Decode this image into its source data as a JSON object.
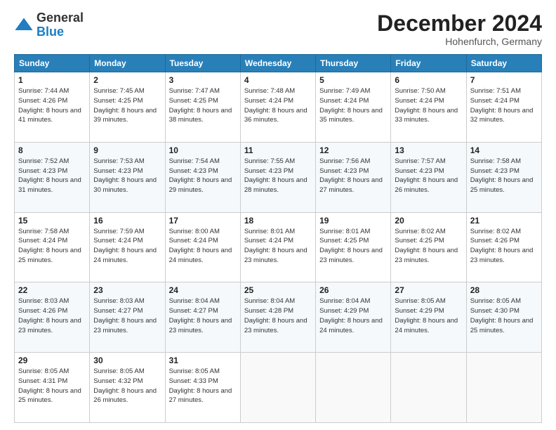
{
  "header": {
    "logo_general": "General",
    "logo_blue": "Blue",
    "month_title": "December 2024",
    "location": "Hohenfurch, Germany"
  },
  "days_of_week": [
    "Sunday",
    "Monday",
    "Tuesday",
    "Wednesday",
    "Thursday",
    "Friday",
    "Saturday"
  ],
  "weeks": [
    [
      {
        "day": "1",
        "text": "Sunrise: 7:44 AM\nSunset: 4:26 PM\nDaylight: 8 hours and 41 minutes."
      },
      {
        "day": "2",
        "text": "Sunrise: 7:45 AM\nSunset: 4:25 PM\nDaylight: 8 hours and 39 minutes."
      },
      {
        "day": "3",
        "text": "Sunrise: 7:47 AM\nSunset: 4:25 PM\nDaylight: 8 hours and 38 minutes."
      },
      {
        "day": "4",
        "text": "Sunrise: 7:48 AM\nSunset: 4:24 PM\nDaylight: 8 hours and 36 minutes."
      },
      {
        "day": "5",
        "text": "Sunrise: 7:49 AM\nSunset: 4:24 PM\nDaylight: 8 hours and 35 minutes."
      },
      {
        "day": "6",
        "text": "Sunrise: 7:50 AM\nSunset: 4:24 PM\nDaylight: 8 hours and 33 minutes."
      },
      {
        "day": "7",
        "text": "Sunrise: 7:51 AM\nSunset: 4:24 PM\nDaylight: 8 hours and 32 minutes."
      }
    ],
    [
      {
        "day": "8",
        "text": "Sunrise: 7:52 AM\nSunset: 4:23 PM\nDaylight: 8 hours and 31 minutes."
      },
      {
        "day": "9",
        "text": "Sunrise: 7:53 AM\nSunset: 4:23 PM\nDaylight: 8 hours and 30 minutes."
      },
      {
        "day": "10",
        "text": "Sunrise: 7:54 AM\nSunset: 4:23 PM\nDaylight: 8 hours and 29 minutes."
      },
      {
        "day": "11",
        "text": "Sunrise: 7:55 AM\nSunset: 4:23 PM\nDaylight: 8 hours and 28 minutes."
      },
      {
        "day": "12",
        "text": "Sunrise: 7:56 AM\nSunset: 4:23 PM\nDaylight: 8 hours and 27 minutes."
      },
      {
        "day": "13",
        "text": "Sunrise: 7:57 AM\nSunset: 4:23 PM\nDaylight: 8 hours and 26 minutes."
      },
      {
        "day": "14",
        "text": "Sunrise: 7:58 AM\nSunset: 4:23 PM\nDaylight: 8 hours and 25 minutes."
      }
    ],
    [
      {
        "day": "15",
        "text": "Sunrise: 7:58 AM\nSunset: 4:24 PM\nDaylight: 8 hours and 25 minutes."
      },
      {
        "day": "16",
        "text": "Sunrise: 7:59 AM\nSunset: 4:24 PM\nDaylight: 8 hours and 24 minutes."
      },
      {
        "day": "17",
        "text": "Sunrise: 8:00 AM\nSunset: 4:24 PM\nDaylight: 8 hours and 24 minutes."
      },
      {
        "day": "18",
        "text": "Sunrise: 8:01 AM\nSunset: 4:24 PM\nDaylight: 8 hours and 23 minutes."
      },
      {
        "day": "19",
        "text": "Sunrise: 8:01 AM\nSunset: 4:25 PM\nDaylight: 8 hours and 23 minutes."
      },
      {
        "day": "20",
        "text": "Sunrise: 8:02 AM\nSunset: 4:25 PM\nDaylight: 8 hours and 23 minutes."
      },
      {
        "day": "21",
        "text": "Sunrise: 8:02 AM\nSunset: 4:26 PM\nDaylight: 8 hours and 23 minutes."
      }
    ],
    [
      {
        "day": "22",
        "text": "Sunrise: 8:03 AM\nSunset: 4:26 PM\nDaylight: 8 hours and 23 minutes."
      },
      {
        "day": "23",
        "text": "Sunrise: 8:03 AM\nSunset: 4:27 PM\nDaylight: 8 hours and 23 minutes."
      },
      {
        "day": "24",
        "text": "Sunrise: 8:04 AM\nSunset: 4:27 PM\nDaylight: 8 hours and 23 minutes."
      },
      {
        "day": "25",
        "text": "Sunrise: 8:04 AM\nSunset: 4:28 PM\nDaylight: 8 hours and 23 minutes."
      },
      {
        "day": "26",
        "text": "Sunrise: 8:04 AM\nSunset: 4:29 PM\nDaylight: 8 hours and 24 minutes."
      },
      {
        "day": "27",
        "text": "Sunrise: 8:05 AM\nSunset: 4:29 PM\nDaylight: 8 hours and 24 minutes."
      },
      {
        "day": "28",
        "text": "Sunrise: 8:05 AM\nSunset: 4:30 PM\nDaylight: 8 hours and 25 minutes."
      }
    ],
    [
      {
        "day": "29",
        "text": "Sunrise: 8:05 AM\nSunset: 4:31 PM\nDaylight: 8 hours and 25 minutes."
      },
      {
        "day": "30",
        "text": "Sunrise: 8:05 AM\nSunset: 4:32 PM\nDaylight: 8 hours and 26 minutes."
      },
      {
        "day": "31",
        "text": "Sunrise: 8:05 AM\nSunset: 4:33 PM\nDaylight: 8 hours and 27 minutes."
      },
      null,
      null,
      null,
      null
    ]
  ]
}
